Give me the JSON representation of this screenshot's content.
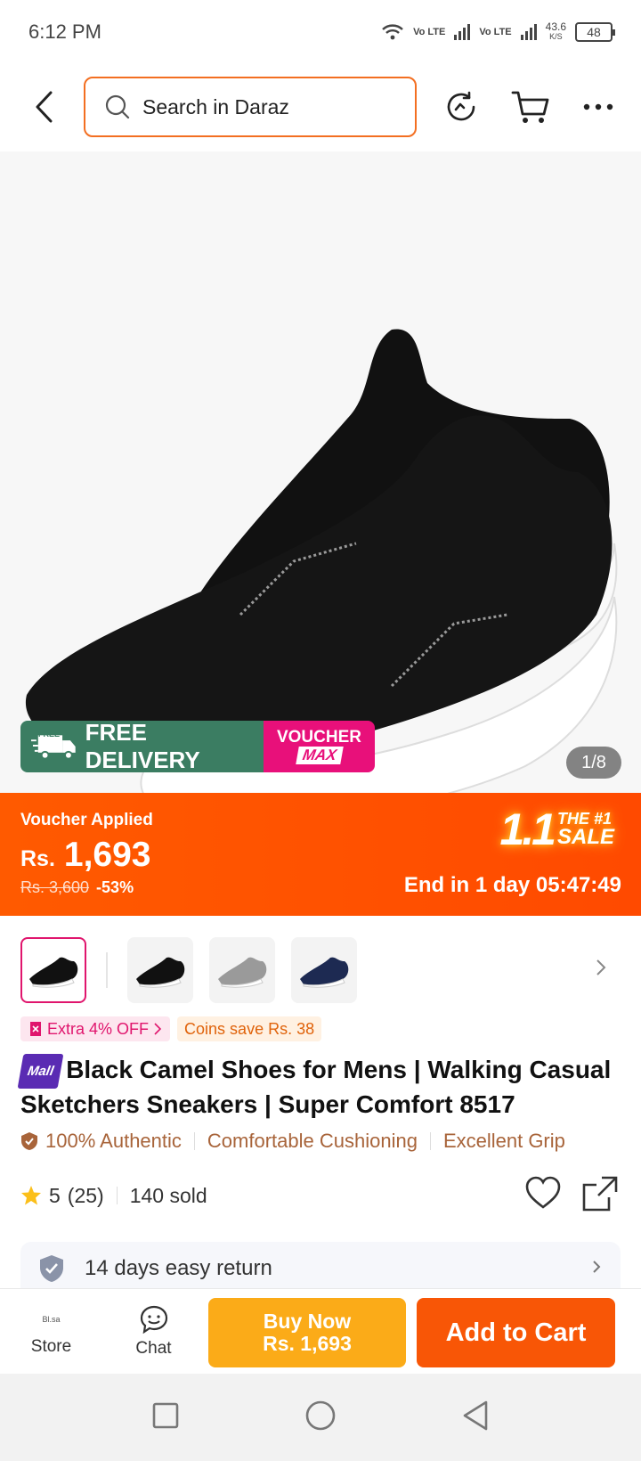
{
  "status_bar": {
    "time": "6:12 PM",
    "speed": "43.6",
    "speed_unit": "K/S",
    "battery": "48",
    "sim1": "Vo LTE",
    "sim2": "Vo LTE"
  },
  "header": {
    "search_placeholder": "Search in Daraz"
  },
  "product": {
    "badges": {
      "free_delivery_tag": "FREE",
      "free_delivery": "FREE DELIVERY",
      "voucher_line1": "VOUCHER",
      "voucher_line2": "MAX"
    },
    "image_counter": "1/8",
    "price": {
      "voucher_label": "Voucher Applied",
      "currency": "Rs.",
      "amount": "1,693",
      "original": "Rs. 3,600",
      "discount": "-53%",
      "sale_big": "1.1",
      "sale_line1": "THE #1",
      "sale_line2": "SALE",
      "countdown": "End in 1 day 05:47:49"
    },
    "variants": [
      "Black (selected)",
      "Black",
      "Grey",
      "Navy"
    ],
    "promos": {
      "extra_off": "Extra 4% OFF",
      "coins": "Coins save Rs. 38"
    },
    "mall_badge": "Mall",
    "title": "Black Camel Shoes for Mens | Walking Casual Sketchers Sneakers | Super Comfort 8517",
    "features": [
      "100% Authentic",
      "Comfortable Cushioning",
      "Excellent Grip"
    ],
    "rating": {
      "score": "5",
      "count": "(25)",
      "sold": "140 sold"
    },
    "return_policy": "14 days easy return"
  },
  "bottom_bar": {
    "store_label": "Store",
    "store_logo": "Bl.sa",
    "chat_label": "Chat",
    "buy_now_line1": "Buy Now",
    "buy_now_line2": "Rs. 1,693",
    "add_to_cart": "Add to Cart"
  },
  "colors": {
    "brand_orange": "#f85606",
    "buy_now": "#fbab18",
    "price_banner": "#ff5000",
    "mall_purple": "#5a2bb3",
    "feature_text": "#a8643a"
  }
}
